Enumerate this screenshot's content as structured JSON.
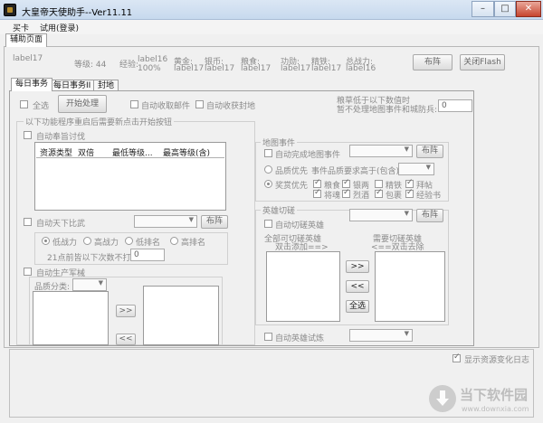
{
  "window": {
    "title": "大皇帝天使助手--Ver11.11",
    "min": "–",
    "max": "□",
    "close": "✕"
  },
  "menu": [
    "买卡",
    "试用(登录)"
  ],
  "top_tab": "辅助页面",
  "info": {
    "labels": [
      "label17",
      "等级: 44",
      "经验:",
      "label16",
      "黄金:",
      "银币:",
      "粮食:",
      "功勋:",
      "精铁:",
      "总战力:"
    ],
    "values": {
      "exp_pct": "100%",
      "gold": "label17",
      "silver": "label17",
      "food": "label17",
      "merit": "label17",
      "iron": "label17",
      "power": "label16"
    },
    "btn_refresh": "布阵",
    "btn_close_flash": "关闭Flash"
  },
  "tabs": [
    "每日事务",
    "每日事务II",
    "封地"
  ],
  "daily": {
    "select_all": "全选",
    "start": "开始处理",
    "auto_mail": "自动收取邮件",
    "auto_fief": "自动收获封地",
    "food_note1": "粮草低于以下数值时",
    "food_note2": "暂不处理地图事件和城防兵:",
    "food_value": "0",
    "note": "以下功能程序重启后需要新点击开始按钮",
    "auto_pirate": "自动奉旨讨伐",
    "table_headers": [
      "资源类型",
      "双倍",
      "最低等级...",
      "最高等级(含)"
    ],
    "auto_world": "自动天下比武",
    "world_btn": "布阵",
    "radios": [
      "低战力",
      "高战力",
      "低排名",
      "高排名"
    ],
    "night_note": "21点前皆以下次数不打:",
    "night_value": "0",
    "auto_produce": "自动生产军械",
    "quality": "品质分类:",
    "arrow_right": ">>",
    "arrow_left": "<<"
  },
  "map": {
    "legend": "地图事件",
    "auto_map": "自动完成地图事件",
    "btn": "布阵",
    "quality_first": "品质优先",
    "quality_req": "事件品质要求高于(包含)",
    "reward_first": "奖赏优先",
    "rewards": [
      "粮食",
      "银两",
      "精铁",
      "拜帖",
      "将魂",
      "烈酒",
      "包裹",
      "经验书"
    ],
    "rewards_checked": [
      true,
      true,
      false,
      true,
      true,
      true,
      true,
      true
    ]
  },
  "hero": {
    "legend": "英雄切磋",
    "btn": "布阵",
    "auto_hero": "自动切磋英雄",
    "left_title1": "全部可切磋英雄",
    "left_title2": "双击添加==>",
    "right_title1": "需要切磋英雄",
    "right_title2": "<==双击去除",
    "btn_add": ">>",
    "btn_remove": "<<",
    "btn_all": "全选",
    "auto_trial": "自动英雄试炼"
  },
  "bottom": {
    "show_log": "显示资源变化日志"
  },
  "watermark": {
    "text": "当下软件园",
    "sub": "www.downxia.com"
  }
}
